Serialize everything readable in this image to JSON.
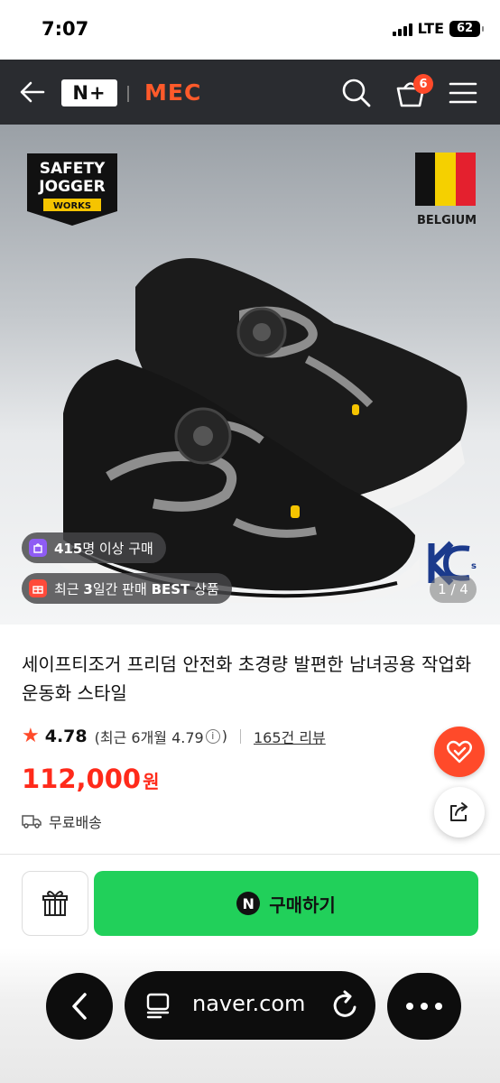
{
  "status_bar": {
    "time": "7:07",
    "network": "LTE",
    "battery": "62"
  },
  "header": {
    "logo_text": "N+",
    "brand": "MEC",
    "cart_count": "6",
    "brand_color": "#ff5a2a"
  },
  "hero": {
    "brand_badge": [
      "SAFETY",
      "JOGGER",
      "WORKS"
    ],
    "country_label": "BELGIUM",
    "purchase_count": "415",
    "purchase_suffix": "명 이상 구매",
    "best_prefix": "최근 ",
    "best_highlight_1": "3",
    "best_mid": "일간 판매 ",
    "best_highlight_2": "BEST",
    "best_suffix": " 상품",
    "page_current": "1",
    "page_total": "4",
    "certification": "KC"
  },
  "product": {
    "title": "세이프티조거 프리덤 안전화 초경량 발편한 남녀공용 작업화 운동화 스타일",
    "rating": "4.78",
    "rating_recent": "(최근 6개월 4.79",
    "rating_close": ")",
    "review_count": "165건 리뷰",
    "price": "112,000",
    "price_unit": "원",
    "shipping": "무료배송"
  },
  "purchase_bar": {
    "npay_label": "N",
    "buy_label": "구매하기",
    "accent_color": "#21d05a"
  },
  "browser": {
    "domain": "naver.com"
  },
  "icons": {
    "back": "back-arrow-icon",
    "search": "search-icon",
    "cart": "cart-icon",
    "menu": "hamburger-menu-icon",
    "like": "heart-check-icon",
    "share": "share-icon",
    "gift": "gift-icon",
    "shipping": "truck-icon"
  }
}
